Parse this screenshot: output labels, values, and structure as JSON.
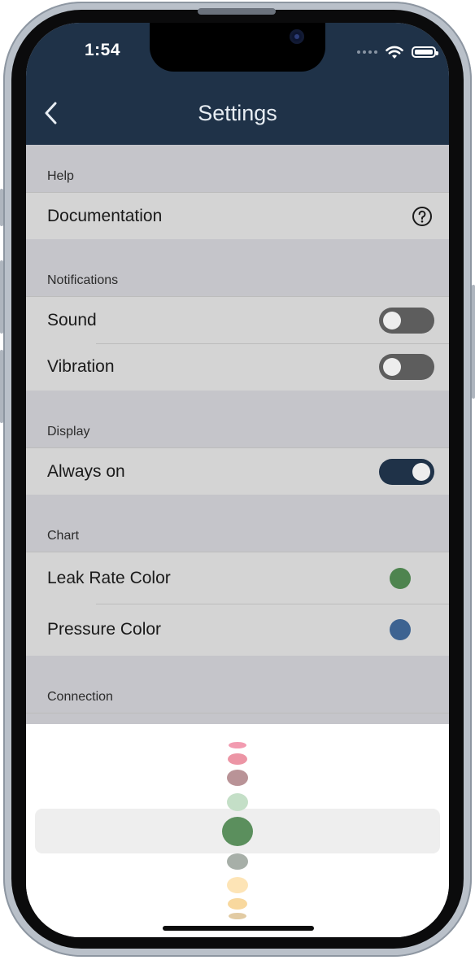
{
  "status_bar": {
    "time": "1:54"
  },
  "nav": {
    "title": "Settings",
    "back_icon": "chevron-left-icon"
  },
  "sections": {
    "help": {
      "header": "Help",
      "documentation_label": "Documentation",
      "help_icon": "question-circle-icon"
    },
    "notifications": {
      "header": "Notifications",
      "sound_label": "Sound",
      "sound_on": false,
      "vibration_label": "Vibration",
      "vibration_on": false
    },
    "display": {
      "header": "Display",
      "always_on_label": "Always on",
      "always_on_on": true
    },
    "chart": {
      "header": "Chart",
      "leak_rate_label": "Leak Rate Color",
      "leak_rate_color": "#4e844f",
      "pressure_label": "Pressure Color",
      "pressure_color": "#3d6391"
    },
    "connection": {
      "header": "Connection"
    }
  },
  "color_picker": {
    "options": [
      "#f29bb0",
      "#ec95a5",
      "#b99397",
      "#c4dfc7",
      "#5b8f5d",
      "#a7afa8",
      "#fde4b6",
      "#f8d89e",
      "#e2cba3"
    ],
    "selected": "#5b8f5d"
  },
  "colors": {
    "header_bg": "#1f3248",
    "list_bg": "#c5c5ca",
    "row_bg": "#d4d4d4"
  }
}
